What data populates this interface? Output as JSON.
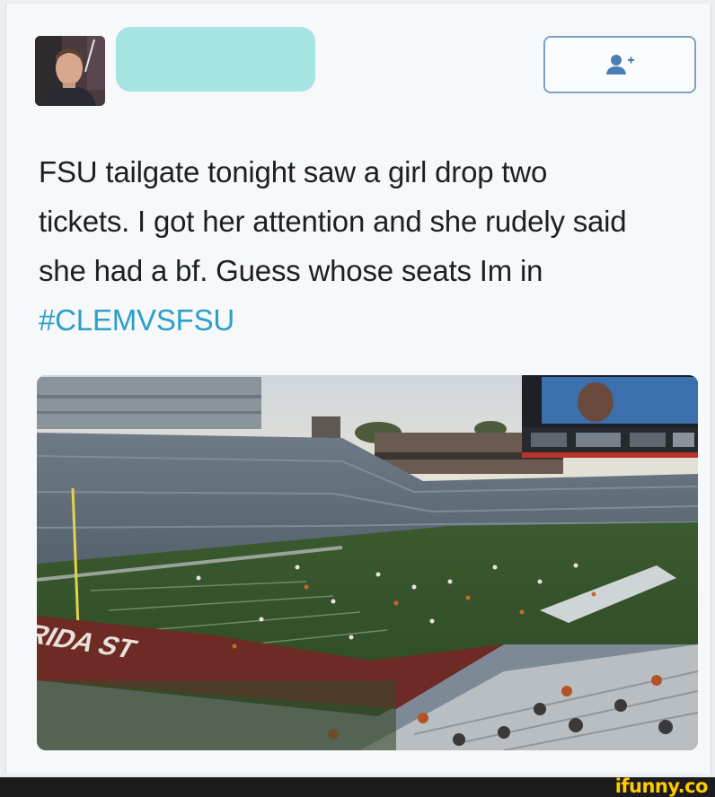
{
  "tweet": {
    "text_lines": [
      "FSU tailgate tonight saw a girl drop two",
      "tickets. I got her attention and she rudely said",
      "she had a bf. Guess whose seats Im in"
    ],
    "hashtag": "#CLEMVSFSU"
  },
  "follow_button": {
    "icon": "add-user-icon"
  },
  "photo": {
    "subject": "football-stadium",
    "endzone_text": "FLORIDA ST"
  },
  "watermark": {
    "text": "ifunny.co"
  },
  "colors": {
    "hashtag": "#2a9fc9",
    "follow_icon": "#4a7fb5",
    "name_redaction": "#a6e4e3",
    "watermark": "#ffcc00"
  }
}
